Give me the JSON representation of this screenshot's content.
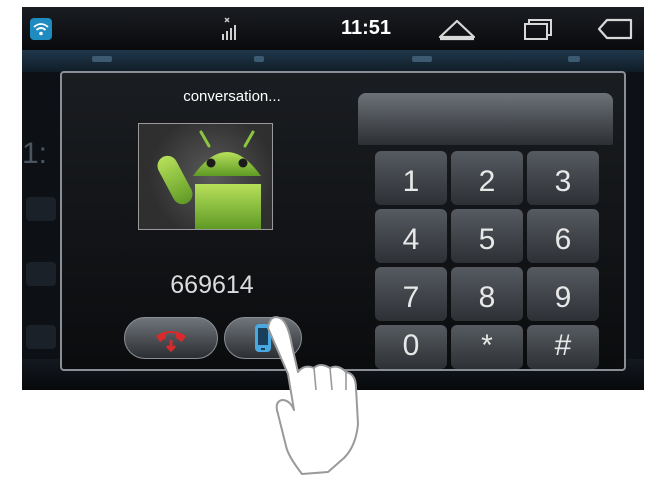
{
  "statusbar": {
    "time": "11:51",
    "icons": [
      "wifi-icon",
      "signal-icon",
      "home-icon",
      "recent-apps-icon",
      "back-icon"
    ]
  },
  "call": {
    "status": "conversation...",
    "number": "669614",
    "avatar": "android-robot-avatar",
    "buttons": [
      "hang-up-icon",
      "phone-handset-icon"
    ]
  },
  "keypad": {
    "keys": [
      "1",
      "2",
      "3",
      "4",
      "5",
      "6",
      "7",
      "8",
      "9",
      "0",
      "*",
      "#"
    ]
  },
  "colors": {
    "background": "#0d1014",
    "accent": "#1e8cc0",
    "hangup_red": "#d82a2a",
    "handset_blue": "#4aa8e0",
    "android_green": "#8cc63f"
  }
}
